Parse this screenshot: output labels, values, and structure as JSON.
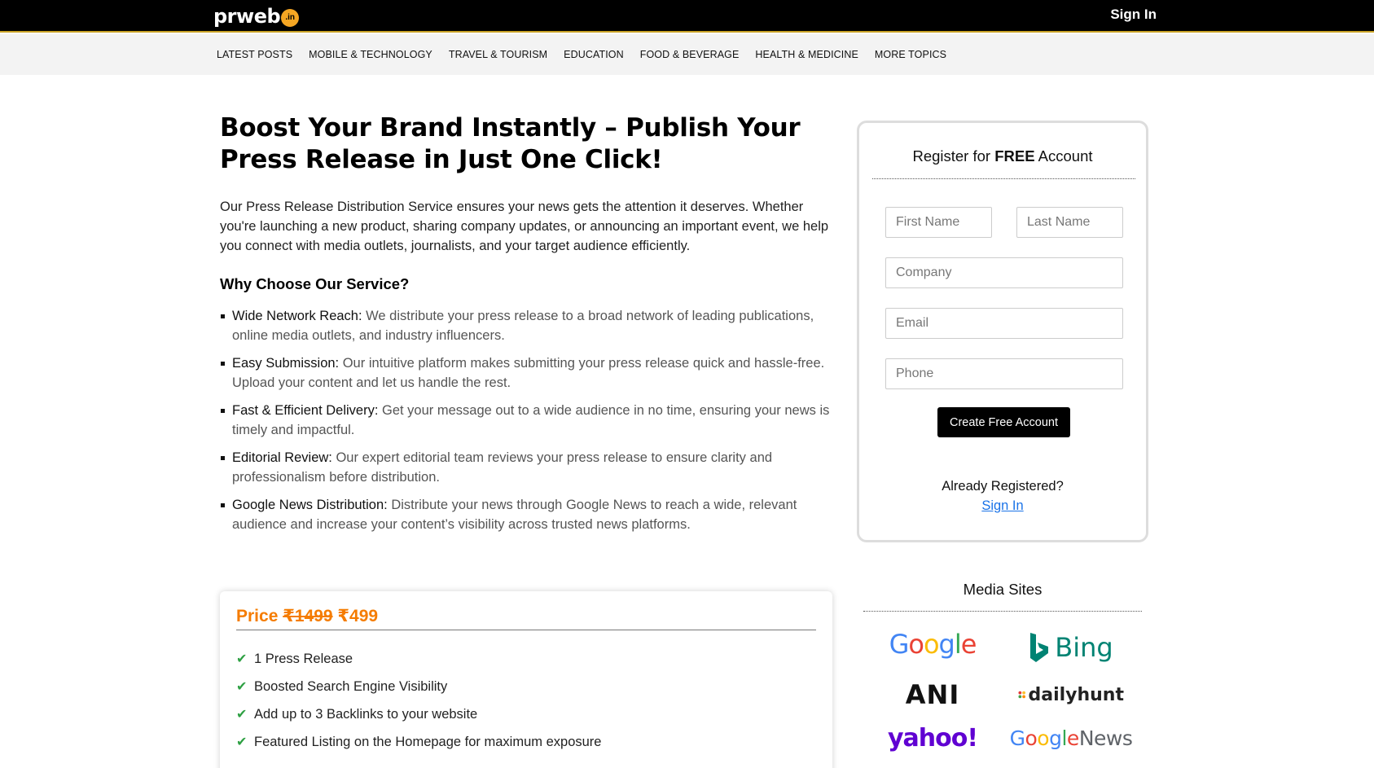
{
  "header": {
    "logo_text": "prweb",
    "logo_badge": ".in",
    "sign_in": "Sign In"
  },
  "nav": {
    "items": [
      "LATEST POSTS",
      "MOBILE & TECHNOLOGY",
      "TRAVEL & TOURISM",
      "EDUCATION",
      "FOOD & BEVERAGE",
      "HEALTH & MEDICINE",
      "MORE TOPICS"
    ]
  },
  "main": {
    "headline": "Boost Your Brand Instantly – Publish Your Press Release in Just One Click!",
    "intro": "Our Press Release Distribution Service ensures your news gets the attention it deserves. Whether you're launching a new product, sharing company updates, or announcing an important event, we help you connect with media outlets, journalists, and your target audience efficiently.",
    "why_title": "Why Choose Our Service?",
    "features": [
      {
        "title": "Wide Network Reach:",
        "desc": " We distribute your press release to a broad network of leading publications, online media outlets, and industry influencers."
      },
      {
        "title": "Easy Submission:",
        "desc": " Our intuitive platform makes submitting your press release quick and hassle-free. Upload your content and let us handle the rest."
      },
      {
        "title": "Fast & Efficient Delivery:",
        "desc": " Get your message out to a wide audience in no time, ensuring your news is timely and impactful."
      },
      {
        "title": "Editorial Review:",
        "desc": " Our expert editorial team reviews your press release to ensure clarity and professionalism before distribution."
      },
      {
        "title": "Google News Distribution:",
        "desc": " Distribute your news through Google News to reach a wide, relevant audience and increase your content’s visibility across trusted news platforms."
      }
    ]
  },
  "price": {
    "label": "Price",
    "old": "₹1499",
    "new": "₹499",
    "items": [
      "1 Press Release",
      "Boosted Search Engine Visibility",
      "Add up to 3 Backlinks to your website",
      "Featured Listing on the Homepage for maximum exposure"
    ]
  },
  "register": {
    "title_prefix": "Register for ",
    "title_bold": "FREE",
    "title_suffix": " Account",
    "first_name_placeholder": "First Name",
    "last_name_placeholder": "Last Name",
    "company_placeholder": "Company",
    "email_placeholder": "Email",
    "phone_placeholder": "Phone",
    "create_button": "Create Free Account",
    "already": "Already Registered?",
    "sign_in": "Sign In"
  },
  "media": {
    "title": "Media Sites",
    "bing": "Bing",
    "ani": "ANI",
    "dailyhunt": "dailyhunt",
    "yahoo": "yahoo!"
  },
  "colors": {
    "accent_price": "#f57c00",
    "check": "#2ea043",
    "link": "#1a73e8"
  }
}
